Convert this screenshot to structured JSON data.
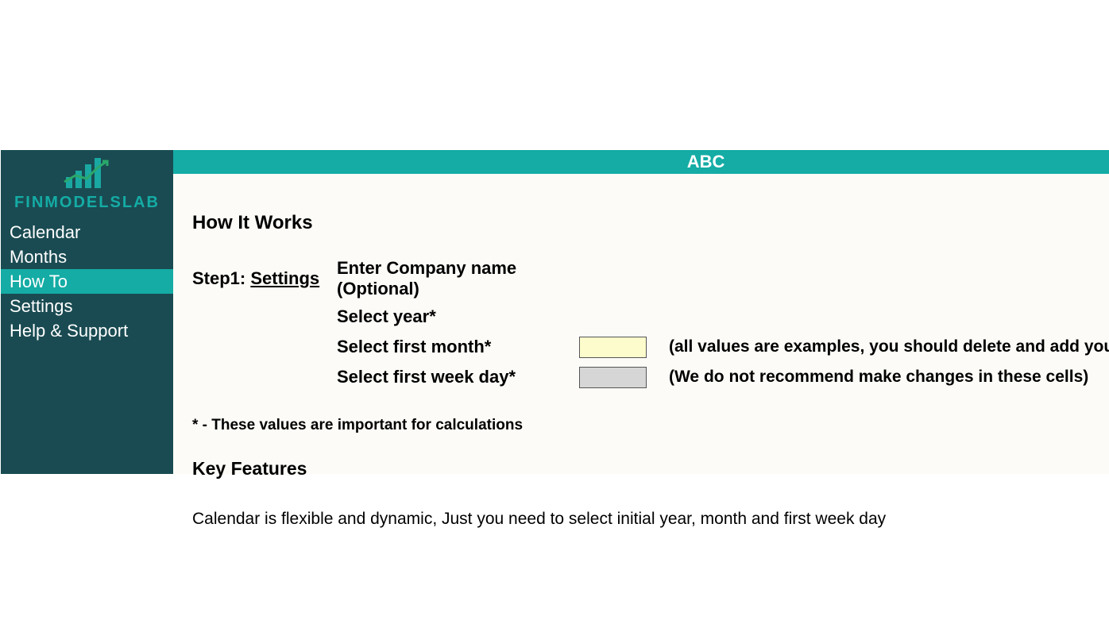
{
  "brand": {
    "logo_text": "FINMODELSLAB"
  },
  "sidebar": {
    "items": [
      {
        "label": "Calendar"
      },
      {
        "label": "Months"
      },
      {
        "label": "How To"
      },
      {
        "label": "Settings"
      },
      {
        "label": "Help & Support"
      }
    ],
    "active_index": 2
  },
  "header": {
    "title": "ABC"
  },
  "content": {
    "section_title": "How It Works",
    "step1_prefix": "Step1: ",
    "step1_link": "Settings",
    "instructions": [
      {
        "text": "Enter Company name (Optional)",
        "cell": null,
        "note": ""
      },
      {
        "text": "Select year*",
        "cell": null,
        "note": ""
      },
      {
        "text": "Select first month*",
        "cell": "yellow",
        "note": "(all values are examples, you should delete and add your new values)"
      },
      {
        "text": "Select first week day*",
        "cell": "gray",
        "note": "(We do not recommend make changes in these cells)"
      }
    ],
    "footnote": "* - These values are important for calculations",
    "key_features_title": "Key Features",
    "feature_text": "Calendar is flexible and dynamic, Just you need to select initial year, month and first week day"
  },
  "colors": {
    "sidebar_bg": "#1a4b52",
    "accent": "#14aca5",
    "main_bg": "#fdfbf7",
    "cell_yellow": "#fdfccc",
    "cell_gray": "#d6d6d6"
  }
}
